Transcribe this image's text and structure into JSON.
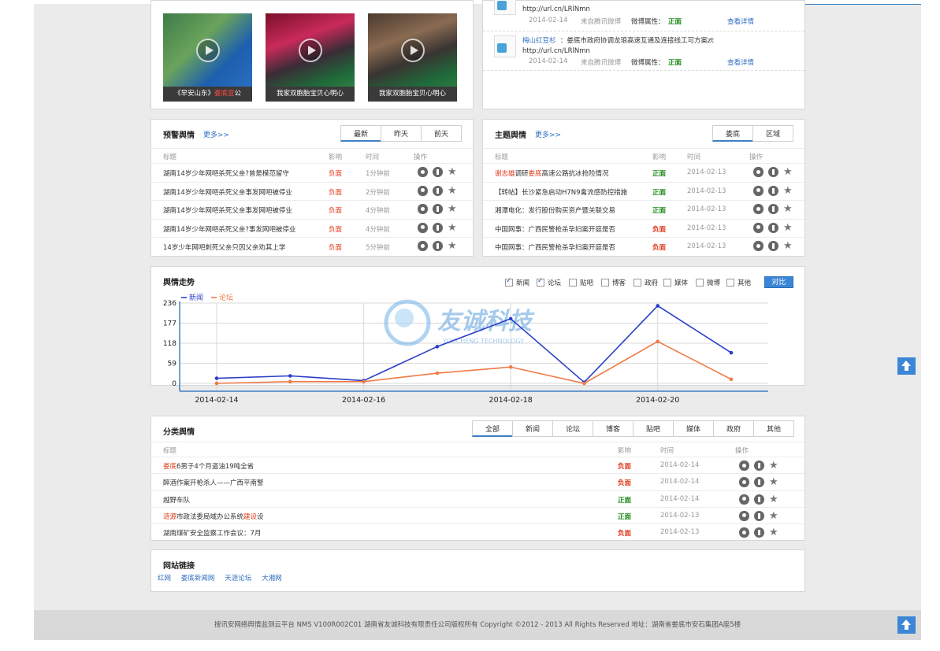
{
  "videos": [
    {
      "caption_pre": "《早安山东》",
      "caption_hl": "娄底亚",
      "caption_post": "公"
    },
    {
      "caption": "我家双胞胎宝贝心明心"
    },
    {
      "caption": "我家双胞胎宝贝心明心"
    }
  ],
  "weibo": {
    "items": [
      {
        "author": "",
        "text": "",
        "url": "http://url.cn/LRlNmn",
        "date": "2014-02-14",
        "source": "来自腾讯微博",
        "attr_label": "微博属性：",
        "attr_value": "正面",
        "detail": "查看详情"
      },
      {
        "author": "梅山红豆杉",
        "text": "：娄底市政府协调龙琅高速互通及连接线工可方案zt",
        "url": "http://url.cn/LRlNmn",
        "date": "2014-02-14",
        "source": "来自腾讯微博",
        "attr_label": "微博属性：",
        "attr_value": "正面",
        "detail": "查看详情"
      }
    ]
  },
  "warning": {
    "title": "预警舆情",
    "more": "更多>>",
    "tabs": [
      "最新",
      "昨天",
      "前天"
    ],
    "headers": {
      "title": "标题",
      "impact": "影响",
      "time": "时间",
      "ops": "操作"
    },
    "rows": [
      {
        "title": "湖南14岁少年网吧杀死父亲?曾是模范留守",
        "impact": "负面",
        "time": "1分钟前"
      },
      {
        "title": "湖南14岁少年网吧杀死父亲事发网吧被停业",
        "impact": "负面",
        "time": "2分钟前"
      },
      {
        "title": "湖南14岁少年网吧杀死父亲事发网吧被停业",
        "impact": "负面",
        "time": "4分钟前"
      },
      {
        "title": "湖南14岁少年网吧杀死父亲?事发网吧被停业",
        "impact": "负面",
        "time": "4分钟前"
      },
      {
        "title": "14岁少年网吧刺死父亲只因父亲劝其上学",
        "impact": "负面",
        "time": "5分钟前"
      }
    ]
  },
  "topic": {
    "title": "主题舆情",
    "more": "更多>>",
    "tabs": [
      "娄底",
      "区域"
    ],
    "headers": {
      "title": "标题",
      "impact": "影响",
      "time": "时间",
      "ops": "操作"
    },
    "rows": [
      {
        "hl1": "谢志雄",
        "mid": "调研",
        "hl2": "娄底",
        "rest": "高速公路抗冰抢险情况",
        "impact": "正面",
        "time": "2014-02-13"
      },
      {
        "hl1": "",
        "mid": "",
        "hl2": "",
        "rest": "【转帖】长沙紧急启动H7N9禽流感防控措施",
        "impact": "正面",
        "time": "2014-02-13"
      },
      {
        "hl1": "",
        "mid": "",
        "hl2": "",
        "rest": "湘潭电化：发行股份购买资产暨关联交易",
        "impact": "正面",
        "time": "2014-02-13"
      },
      {
        "hl1": "",
        "mid": "",
        "hl2": "",
        "rest": "中国网事：广西民警枪杀孕妇案开庭是否",
        "impact": "负面",
        "time": "2014-02-13"
      },
      {
        "hl1": "",
        "mid": "",
        "hl2": "",
        "rest": "中国网事：广西民警枪杀孕妇案开庭是否",
        "impact": "负面",
        "time": "2014-02-13"
      }
    ]
  },
  "trend": {
    "title": "舆情走势",
    "filters": [
      {
        "label": "新闻",
        "checked": true
      },
      {
        "label": "论坛",
        "checked": true
      },
      {
        "label": "贴吧",
        "checked": false
      },
      {
        "label": "博客",
        "checked": false
      },
      {
        "label": "政府",
        "checked": false
      },
      {
        "label": "媒体",
        "checked": false
      },
      {
        "label": "微博",
        "checked": false
      },
      {
        "label": "其他",
        "checked": false
      }
    ],
    "compare": "对比",
    "watermark_cn": "友诚科技",
    "watermark_en": "YOUCHENG TECHNOLOGY"
  },
  "chart_data": {
    "type": "line",
    "x": [
      "2014-02-14",
      "2014-02-15",
      "2014-02-16",
      "2014-02-17",
      "2014-02-18",
      "2014-02-19",
      "2014-02-20",
      "2014-02-21"
    ],
    "xticks": [
      "2014-02-14",
      "2014-02-16",
      "2014-02-18",
      "2014-02-20"
    ],
    "yticks": [
      0,
      59,
      118,
      177,
      236
    ],
    "ylim": [
      0,
      236
    ],
    "series": [
      {
        "name": "新闻",
        "color": "#2a3ec8",
        "values": [
          15,
          22,
          8,
          108,
          190,
          3,
          228,
          90
        ]
      },
      {
        "name": "论坛",
        "color": "#f07a45",
        "values": [
          0,
          5,
          5,
          30,
          48,
          0,
          123,
          12
        ]
      }
    ],
    "legend": "top-left",
    "grid": true
  },
  "category": {
    "title": "分类舆情",
    "tabs": [
      "全部",
      "新闻",
      "论坛",
      "博客",
      "贴吧",
      "媒体",
      "政府",
      "其他"
    ],
    "headers": {
      "title": "标题",
      "impact": "影响",
      "time": "时间",
      "ops": "操作"
    },
    "rows": [
      {
        "hl": "娄底",
        "pre": "",
        "text": "6男子4个月盗油19吨全省",
        "impact": "负面",
        "time": "2014-02-14"
      },
      {
        "hl": "",
        "pre": "",
        "text": "醉酒作案开枪杀人——广西平南警",
        "impact": "负面",
        "time": "2014-02-14"
      },
      {
        "hl": "",
        "pre": "",
        "text": "越野车队",
        "impact": "正面",
        "time": "2014-02-14"
      },
      {
        "hl": "涟源",
        "pre": "",
        "text": "市政法委局域办公系统",
        "hl2": "建设",
        "post": "设",
        "impact": "正面",
        "time": "2014-02-13"
      },
      {
        "hl": "",
        "pre": "",
        "text": "湖南煤矿安全监察工作会议：7月",
        "impact": "负面",
        "time": "2014-02-13"
      }
    ]
  },
  "links": {
    "title": "网站链接",
    "items": [
      "红网",
      "娄底新闻网",
      "天涯论坛",
      "大湘网"
    ]
  },
  "footer": {
    "text": "搜讯安网络舆情监测云平台 NMS V100R002C01 湖南省友诚科技有限责任公司版权所有 Copyright ©2012 - 2013 All Rights Reserved 地址：湖南省娄底市安石集团A座5楼"
  },
  "colors": {
    "accent": "#3f7fc2",
    "negative": "#e03b1e",
    "positive": "#1b8a16"
  }
}
